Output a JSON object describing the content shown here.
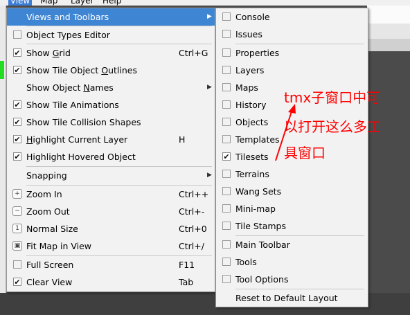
{
  "menubar": {
    "view": "View",
    "map": "Map",
    "layer": "Layer",
    "help": "Help"
  },
  "view_menu": {
    "views_and_toolbars": "Views and Toolbars",
    "object_types_editor": "Object Types Editor",
    "show_grid": {
      "label": "Show Grid",
      "shortcut": "Ctrl+G",
      "checked": true
    },
    "show_tile_object_outlines": {
      "label": "Show Tile Object Outlines",
      "checked": true
    },
    "show_object_names": "Show Object Names",
    "show_tile_animations": {
      "label": "Show Tile Animations",
      "checked": true
    },
    "show_tile_collision_shapes": {
      "label": "Show Tile Collision Shapes",
      "checked": true
    },
    "highlight_current_layer": {
      "label": "Highlight Current Layer",
      "shortcut": "H",
      "checked": true
    },
    "highlight_hovered_object": {
      "label": "Highlight Hovered Object",
      "checked": true
    },
    "snapping": "Snapping",
    "zoom_in": {
      "label": "Zoom In",
      "shortcut": "Ctrl++"
    },
    "zoom_out": {
      "label": "Zoom Out",
      "shortcut": "Ctrl+-"
    },
    "normal_size": {
      "label": "Normal Size",
      "shortcut": "Ctrl+0"
    },
    "fit_map_in_view": {
      "label": "Fit Map in View",
      "shortcut": "Ctrl+/"
    },
    "full_screen": {
      "label": "Full Screen",
      "shortcut": "F11",
      "checked": false
    },
    "clear_view": {
      "label": "Clear View",
      "shortcut": "Tab",
      "checked": true
    }
  },
  "views_submenu": {
    "console": {
      "label": "Console",
      "checked": false
    },
    "issues": {
      "label": "Issues",
      "checked": false
    },
    "properties": {
      "label": "Properties",
      "checked": false
    },
    "layers": {
      "label": "Layers",
      "checked": false
    },
    "maps": {
      "label": "Maps",
      "checked": false
    },
    "history": {
      "label": "History",
      "checked": false
    },
    "objects": {
      "label": "Objects",
      "checked": false
    },
    "templates": {
      "label": "Templates",
      "checked": false
    },
    "tilesets": {
      "label": "Tilesets",
      "checked": true
    },
    "terrains": {
      "label": "Terrains",
      "checked": false
    },
    "wang_sets": {
      "label": "Wang Sets",
      "checked": false
    },
    "mini_map": {
      "label": "Mini-map",
      "checked": false
    },
    "tile_stamps": {
      "label": "Tile Stamps",
      "checked": false
    },
    "main_toolbar": {
      "label": "Main Toolbar",
      "checked": false
    },
    "tools": {
      "label": "Tools",
      "checked": false
    },
    "tool_options": {
      "label": "Tool Options",
      "checked": false
    },
    "reset_layout": "Reset to Default Layout"
  },
  "annotation": {
    "line1": "tmx子窗口中可",
    "line2": "以打开这么多工",
    "line3": "具窗口",
    "color": "#ff0000"
  },
  "colors": {
    "highlight": "#3e86d3",
    "menu_bg": "#f2f2f2"
  },
  "check_glyph": "✔"
}
